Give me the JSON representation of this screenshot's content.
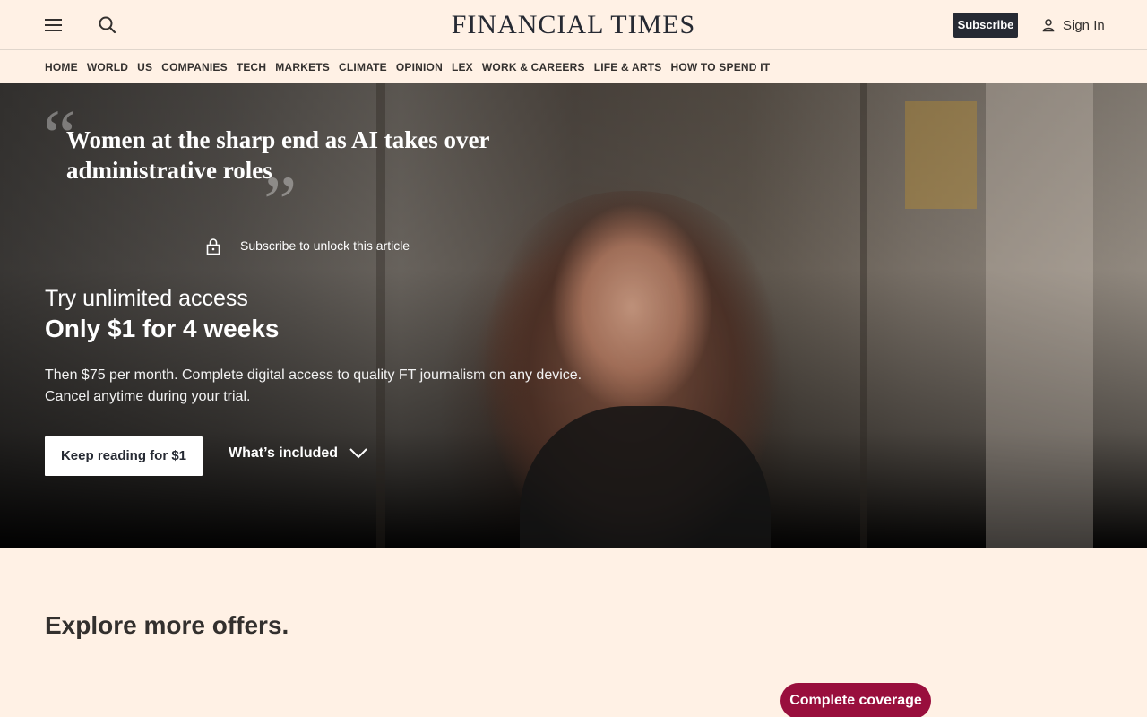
{
  "header": {
    "logo": "FINANCIAL TIMES",
    "subscribe_label": "Subscribe",
    "signin_label": "Sign In"
  },
  "nav": {
    "items": [
      "HOME",
      "WORLD",
      "US",
      "COMPANIES",
      "TECH",
      "MARKETS",
      "CLIMATE",
      "OPINION",
      "LEX",
      "WORK & CAREERS",
      "LIFE & ARTS",
      "HOW TO SPEND IT"
    ]
  },
  "hero": {
    "headline": "Women at the sharp end as AI takes over administrative roles",
    "quote_open": "“",
    "quote_close": "”",
    "unlock_text": "Subscribe to unlock this article",
    "try_text": "Try unlimited access",
    "price_text": "Only $1 for 4 weeks",
    "description": "Then $75 per month. Complete digital access to quality FT journalism on any device. Cancel anytime during your trial.",
    "keep_reading_label": "Keep reading for $1",
    "whats_included_label": "What’s included"
  },
  "offers": {
    "heading": "Explore more offers.",
    "coverage_label": "Complete coverage"
  },
  "colors": {
    "page_bg": "#fff1e5",
    "dark_button": "#262a33",
    "accent_claret": "#990f3d"
  },
  "icons": {
    "menu": "hamburger-icon",
    "search": "search-icon",
    "user": "user-icon",
    "lock": "lock-icon",
    "chevron": "chevron-down-icon"
  }
}
